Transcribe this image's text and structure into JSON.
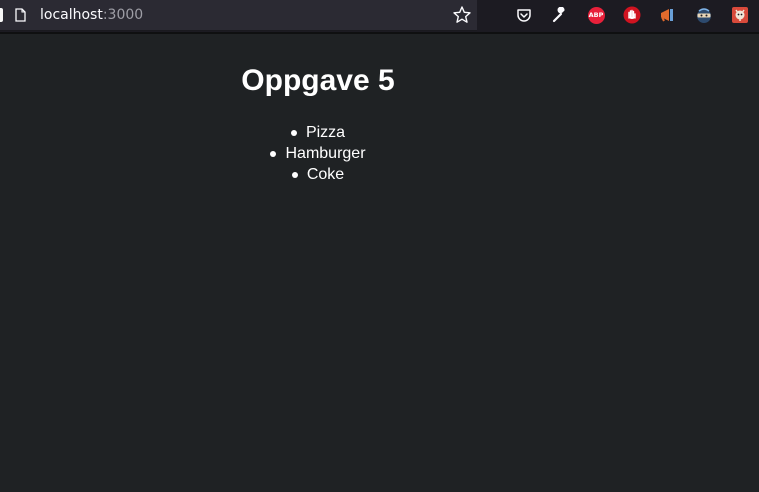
{
  "browser": {
    "url_host": "localhost",
    "url_port": ":3000",
    "toolbar_icons": [
      "pocket-icon",
      "wrench-icon",
      "adblock-plus-icon",
      "ublock-icon",
      "megaphone-icon",
      "ninja-icon",
      "extension-icon"
    ],
    "adblock_label": "ABP"
  },
  "page": {
    "title": "Oppgave 5",
    "items": [
      "Pizza",
      "Hamburger",
      "Coke"
    ]
  },
  "colors": {
    "page_background": "#1f2224",
    "text": "#ffffff",
    "toolbar_background": "#1c1b22",
    "urlbar_background": "#2b2a33"
  }
}
